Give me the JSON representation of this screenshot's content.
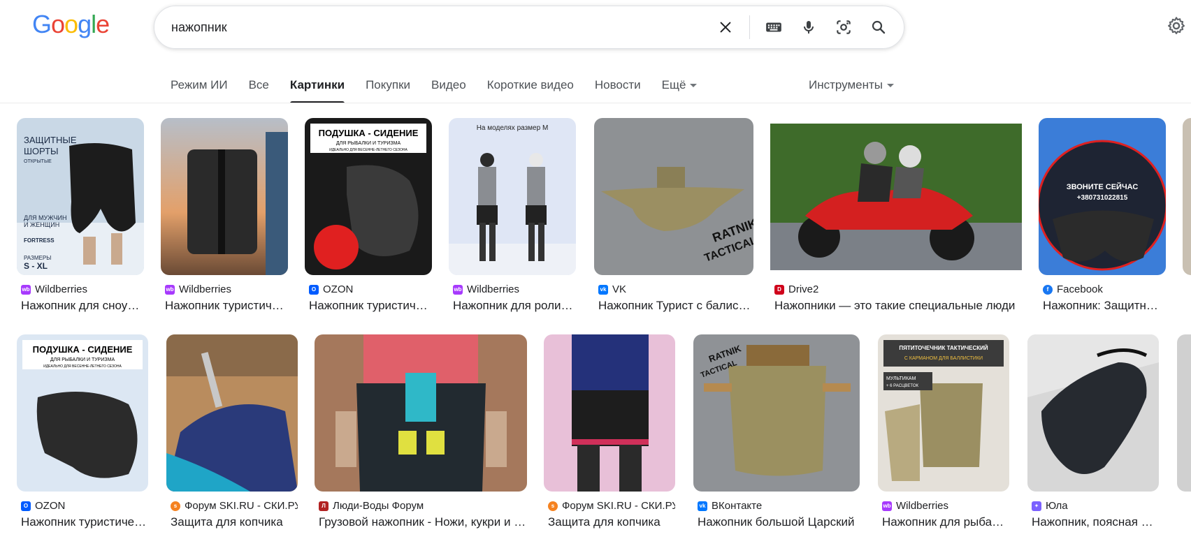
{
  "search": {
    "query": "нажопник"
  },
  "tabs": [
    {
      "label": "Режим ИИ"
    },
    {
      "label": "Все"
    },
    {
      "label": "Картинки"
    },
    {
      "label": "Покупки"
    },
    {
      "label": "Видео"
    },
    {
      "label": "Короткие видео"
    },
    {
      "label": "Новости"
    },
    {
      "label": "Ещё"
    }
  ],
  "tools": {
    "label": "Инструменты"
  },
  "row1": [
    {
      "source": "Wildberries",
      "title": "Нажопник для сноубординга",
      "fav": "#a73afd"
    },
    {
      "source": "Wildberries",
      "title": "Нажопник туристический",
      "fav": "#a73afd"
    },
    {
      "source": "OZON",
      "title": "Нажопник туристический",
      "fav": "#005bff"
    },
    {
      "source": "Wildberries",
      "title": "Нажопник для роликов",
      "fav": "#a73afd"
    },
    {
      "source": "VK",
      "title": "Нажопник Турист с балистикой",
      "fav": "#0077ff"
    },
    {
      "source": "Drive2",
      "title": "Нажопники — это такие специальные люди",
      "fav": "#d0021b"
    },
    {
      "source": "Facebook",
      "title": "Нажопник: Защитные шорты",
      "fav": "#1877f2"
    }
  ],
  "row2": [
    {
      "source": "OZON",
      "title": "Нажопник туристический",
      "fav": "#005bff"
    },
    {
      "source": "Форум SKI.RU - СКИ.РУ",
      "title": "Защита для копчика",
      "fav": "#f58220"
    },
    {
      "source": "Люди-Воды Форум",
      "title": "Грузовой нажопник - Ножи, кукри и прочее",
      "fav": "#b22222"
    },
    {
      "source": "Форум SKI.RU - СКИ.РУ",
      "title": "Защита для копчика",
      "fav": "#f58220"
    },
    {
      "source": "ВКонтакте",
      "title": "Нажопник большой Царский",
      "fav": "#0077ff"
    },
    {
      "source": "Wildberries",
      "title": "Нажопник для рыбалки",
      "fav": "#a73afd"
    },
    {
      "source": "Юла",
      "title": "Нажопник, поясная сумка",
      "fav": "#7b61ff"
    }
  ],
  "thumb_text": {
    "t1": [
      "ЗАЩИТНЫЕ",
      "ШОРТЫ",
      "ОТКРЫТЫЕ",
      "ДЛЯ МУЖЧИН",
      "И ЖЕНЩИН",
      "FORTRESS",
      "РАЗМЕРЫ",
      "S - XL"
    ],
    "t3": [
      "ПОДУШКА - СИДЕНИЕ",
      "ДЛЯ РЫБАЛКИ И ТУРИЗМА",
      "ИДЕАЛЬНО ДЛЯ ВЕСЕННЕ-ЛЕТНЕГО СЕЗОНА"
    ],
    "t4": [
      "На моделях размер М"
    ],
    "t5": [
      "RATNIK",
      "TACTICAL"
    ],
    "t7": [
      "ЗВОНИТЕ СЕЙЧАС",
      "+380731022815"
    ],
    "t13": [
      "ПЯТИТОЧЕЧНИК ТАКТИЧЕСКИЙ",
      "С КАРМАНОМ ДЛЯ БАЛЛИСТИКИ",
      "МУЛЬТИКАМ",
      "+ 6 РАСЦВЕТОК"
    ]
  },
  "colors": {
    "google_blue": "#4285f4",
    "google_red": "#ea4335",
    "google_yellow": "#fbbc05",
    "google_green": "#34a853"
  }
}
